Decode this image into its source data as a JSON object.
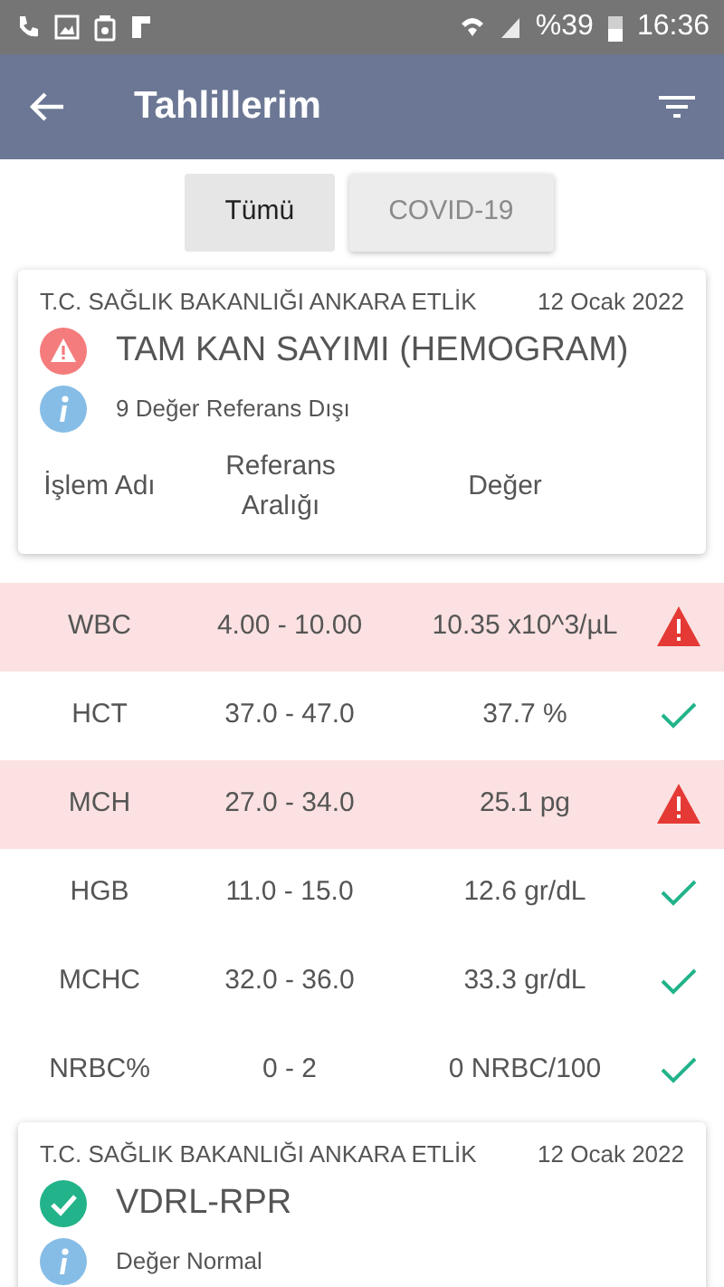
{
  "status_bar": {
    "battery": "%39",
    "time": "16:36"
  },
  "app_bar": {
    "title": "Tahlillerim"
  },
  "filters": [
    {
      "label": "Tümü",
      "selected": true
    },
    {
      "label": "COVID-19",
      "selected": false
    }
  ],
  "cards": [
    {
      "institution": "T.C. SAĞLIK BAKANLIĞI ANKARA ETLİK",
      "date": "12 Ocak 2022",
      "kind": "warning",
      "test_name": "TAM KAN SAYIMI (HEMOGRAM)",
      "summary": "9 Değer Referans Dışı",
      "columns": [
        "İşlem Adı",
        "Referans Aralığı",
        "Değer"
      ],
      "rows": [
        {
          "name": "WBC",
          "range": "4.00 - 10.00",
          "value": "10.35 x10^3/µL",
          "abnormal": true
        },
        {
          "name": "HCT",
          "range": "37.0 - 47.0",
          "value": "37.7 %",
          "abnormal": false
        },
        {
          "name": "MCH",
          "range": "27.0 - 34.0",
          "value": "25.1 pg",
          "abnormal": true
        },
        {
          "name": "HGB",
          "range": "11.0 - 15.0",
          "value": "12.6 gr/dL",
          "abnormal": false
        },
        {
          "name": "MCHC",
          "range": "32.0 - 36.0",
          "value": "33.3 gr/dL",
          "abnormal": false
        },
        {
          "name": "NRBC%",
          "range": "0 - 2",
          "value": "0 NRBC/100",
          "abnormal": false
        }
      ]
    },
    {
      "institution": "T.C. SAĞLIK BAKANLIĞI ANKARA ETLİK",
      "date": "12 Ocak 2022",
      "kind": "normal",
      "test_name": "VDRL-RPR",
      "summary": "Değer Normal"
    }
  ]
}
